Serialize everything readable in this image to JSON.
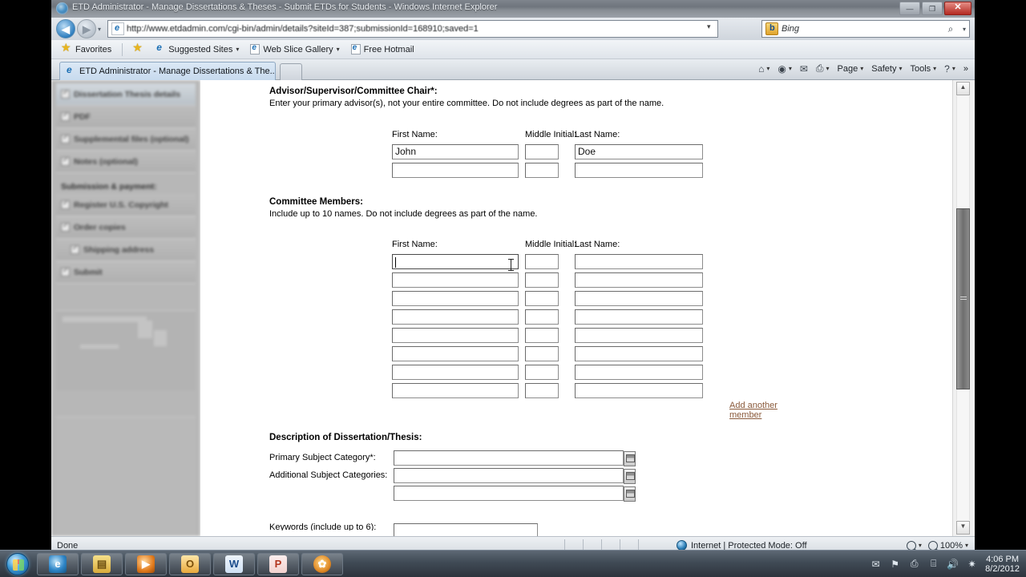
{
  "window": {
    "title": "ETD Administrator - Manage Dissertations & Theses - Submit ETDs for Students - Windows Internet Explorer",
    "minimize_label": "—",
    "restore_label": "❐",
    "close_label": "✕"
  },
  "navigation": {
    "back_label": "◀",
    "forward_label": "▶",
    "address_url": "http://www.etdadmin.com/cgi-bin/admin/details?siteId=387;submissionId=168910;saved=1",
    "address_domain": "www.etdadmin.com",
    "address_prefix": "http://",
    "address_suffix": "/cgi-bin/admin/details?siteId=387;submissionId=168910;saved=1",
    "compat_icon": "compatibility-view-icon",
    "refresh_label": "↻",
    "stop_label": "✕",
    "search_engine": "Bing",
    "search_placeholder": "Bing",
    "search_go_label": "🔍",
    "search_dropdown_label": "▾"
  },
  "favorites_bar": {
    "favorites_label": "Favorites",
    "items": [
      {
        "label": "Suggested Sites",
        "has_caret": true
      },
      {
        "label": "Web Slice Gallery",
        "has_caret": true
      },
      {
        "label": "Free Hotmail",
        "has_caret": false
      }
    ]
  },
  "tabs": {
    "active_tab": "ETD Administrator - Manage Dissertations & The...",
    "new_tab_label": ""
  },
  "command_bar": {
    "home_glyph": "⌂",
    "feeds_glyph": "◉",
    "mail_glyph": "✉",
    "print_glyph": "⎙",
    "caret": "▾",
    "items": [
      {
        "label": "Page"
      },
      {
        "label": "Safety"
      },
      {
        "label": "Tools"
      }
    ],
    "help_glyph": "?",
    "overflow_label": "»"
  },
  "sidebar": {
    "items": [
      {
        "label": "Dissertation Thesis details",
        "checked": true,
        "active": true,
        "indent": false
      },
      {
        "label": "PDF",
        "checked": true,
        "active": false,
        "indent": false
      },
      {
        "label": "Supplemental files (optional)",
        "checked": true,
        "active": false,
        "indent": false
      },
      {
        "label": "Notes (optional)",
        "checked": true,
        "active": false,
        "indent": false
      }
    ],
    "section_label": "Submission & payment:",
    "payment_items": [
      {
        "label": "Register U.S. Copyright",
        "checked": true,
        "indent": false
      },
      {
        "label": "Order copies",
        "checked": true,
        "indent": false
      },
      {
        "label": "Shipping address",
        "checked": true,
        "indent": true
      },
      {
        "label": "Submit",
        "checked": true,
        "indent": false
      }
    ]
  },
  "form": {
    "advisor": {
      "heading": "Advisor/Supervisor/Committee Chair*:",
      "instructions": "Enter your primary advisor(s), not your entire committee. Do not include degrees as part of the name.",
      "col_first": "First Name:",
      "col_middle": "Middle Initial:",
      "col_last": "Last Name:",
      "rows": [
        {
          "first": "John",
          "middle": "",
          "last": "Doe"
        },
        {
          "first": "",
          "middle": "",
          "last": ""
        }
      ]
    },
    "committee": {
      "heading": "Committee Members:",
      "instructions": "Include up to 10 names. Do not include degrees as part of the name.",
      "col_first": "First Name:",
      "col_middle": "Middle Initial:",
      "col_last": "Last Name:",
      "rows": [
        {
          "first": "",
          "middle": "",
          "last": "",
          "focused": true
        },
        {
          "first": "",
          "middle": "",
          "last": "",
          "focused": false
        },
        {
          "first": "",
          "middle": "",
          "last": "",
          "focused": false
        },
        {
          "first": "",
          "middle": "",
          "last": "",
          "focused": false
        },
        {
          "first": "",
          "middle": "",
          "last": "",
          "focused": false
        },
        {
          "first": "",
          "middle": "",
          "last": "",
          "focused": false
        },
        {
          "first": "",
          "middle": "",
          "last": "",
          "focused": false
        },
        {
          "first": "",
          "middle": "",
          "last": "",
          "focused": false
        }
      ],
      "add_link": "Add another member"
    },
    "description": {
      "heading": "Description of Dissertation/Thesis:",
      "primary_label": "Primary Subject Category*:",
      "primary_value": "",
      "additional_label": "Additional Subject Categories:",
      "additional_values": [
        "",
        ""
      ],
      "picker_icon": "category-picker-icon",
      "keywords_label": "Keywords (include up to 6):",
      "keywords_value": ""
    }
  },
  "scrollbar": {
    "up_label": "▲",
    "down_label": "▼"
  },
  "status_bar": {
    "status_text": "Done",
    "zone_text": "Internet | Protected Mode: Off",
    "zoom_level": "100%",
    "zoom_caret": "▾",
    "privacy_caret": "▾"
  },
  "taskbar": {
    "start_label": "Start",
    "apps": [
      {
        "name": "internet-explorer",
        "glyph": "e"
      },
      {
        "name": "windows-explorer",
        "glyph": "▤"
      },
      {
        "name": "windows-media-player",
        "glyph": "▶"
      },
      {
        "name": "outlook",
        "glyph": "O"
      },
      {
        "name": "word",
        "glyph": "W"
      },
      {
        "name": "powerpoint",
        "glyph": "P"
      },
      {
        "name": "flower-app",
        "glyph": "✿"
      }
    ],
    "tray_icons": [
      {
        "name": "mail-tray-icon",
        "glyph": "✉"
      },
      {
        "name": "flag-error-tray-icon",
        "glyph": "⚑"
      },
      {
        "name": "printer-tray-icon",
        "glyph": "⎙"
      },
      {
        "name": "network-tray-icon",
        "glyph": "⌸"
      },
      {
        "name": "volume-tray-icon",
        "glyph": "🔊"
      },
      {
        "name": "security-tray-icon",
        "glyph": "✷"
      }
    ],
    "clock_time": "4:06 PM",
    "clock_date": "8/2/2012"
  },
  "colors": {
    "link": "#8a5a3b",
    "accent": "#2f7fc0",
    "taskbar": "#404a55"
  }
}
